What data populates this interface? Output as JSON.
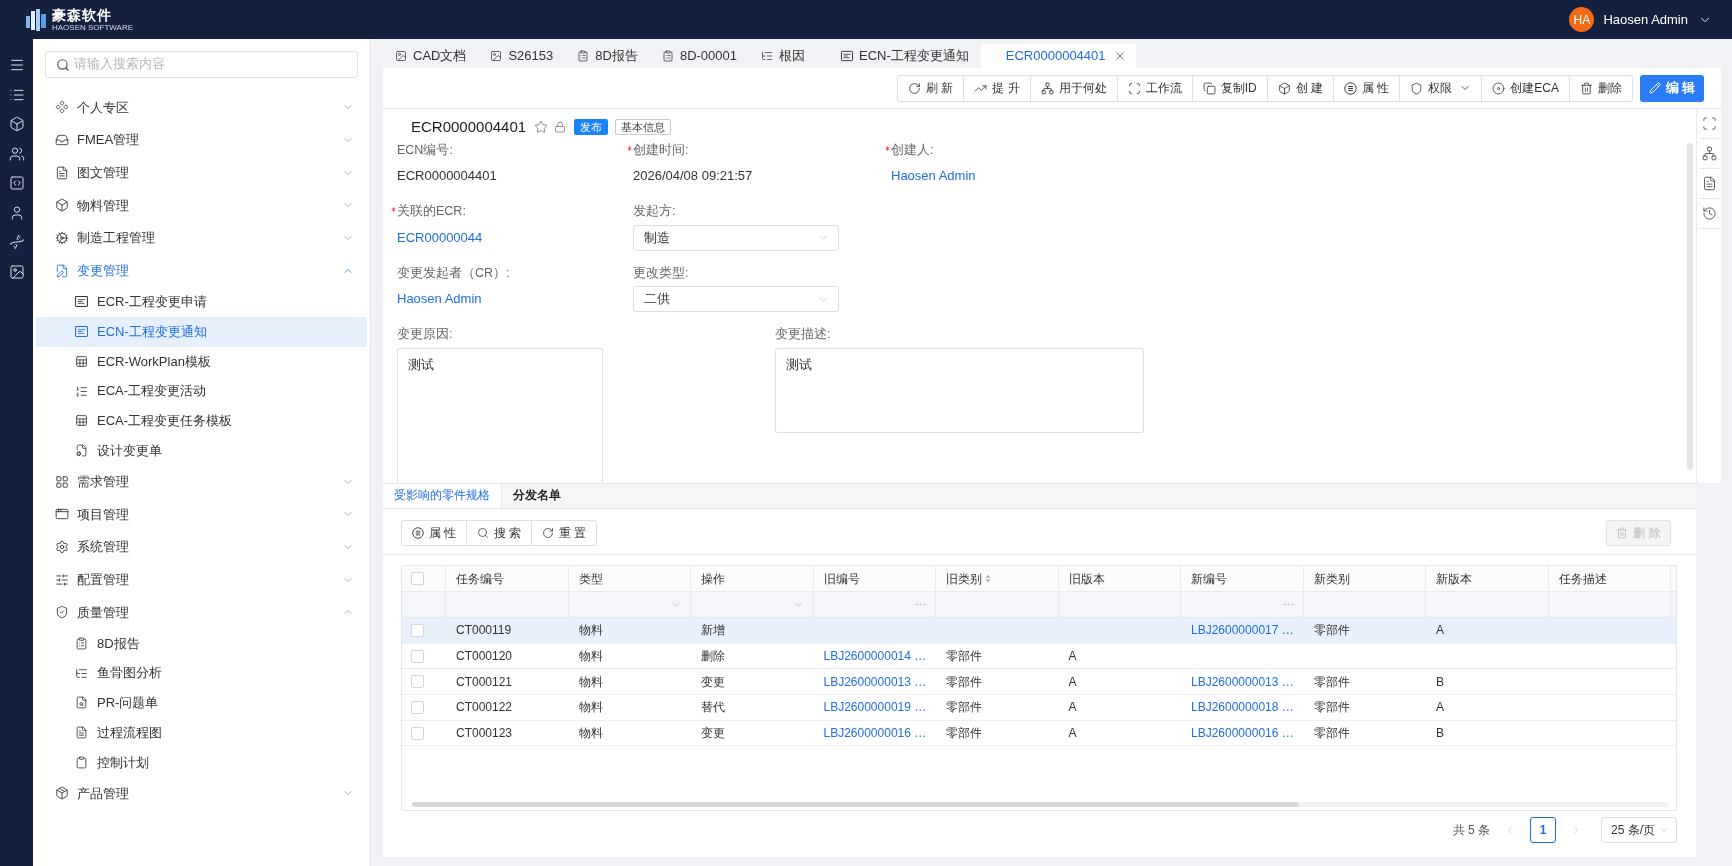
{
  "header": {
    "logo_text": "豪森软件",
    "logo_subtext": "HAOSEN SOFTWARE",
    "user": {
      "initials": "HA",
      "name": "Haosen Admin"
    }
  },
  "sidebar": {
    "search": {
      "placeholder": "请输入搜索内容"
    },
    "items": [
      {
        "label": "个人专区",
        "selected": false,
        "expanded": false
      },
      {
        "label": "FMEA管理",
        "selected": false,
        "expanded": false
      },
      {
        "label": "图文管理",
        "selected": false,
        "expanded": false
      },
      {
        "label": "物料管理",
        "selected": false,
        "expanded": false
      },
      {
        "label": "制造工程管理",
        "selected": false,
        "expanded": false
      },
      {
        "label": "变更管理",
        "selected": true,
        "expanded": true,
        "children": [
          {
            "label": "ECR-工程变更申请",
            "selected": false
          },
          {
            "label": "ECN-工程变更通知",
            "selected": true
          },
          {
            "label": "ECR-WorkPlan模板",
            "selected": false
          },
          {
            "label": "ECA-工程变更活动",
            "selected": false
          },
          {
            "label": "ECA-工程变更任务模板",
            "selected": false
          },
          {
            "label": "设计变更单",
            "selected": false
          }
        ]
      },
      {
        "label": "需求管理",
        "selected": false,
        "expanded": false
      },
      {
        "label": "项目管理",
        "selected": false,
        "expanded": false
      },
      {
        "label": "系统管理",
        "selected": false,
        "expanded": false
      },
      {
        "label": "配置管理",
        "selected": false,
        "expanded": false
      },
      {
        "label": "质量管理",
        "selected": false,
        "expanded": true,
        "children": [
          {
            "label": "8D报告",
            "selected": false
          },
          {
            "label": "鱼骨图分析",
            "selected": false
          },
          {
            "label": "PR-问题单",
            "selected": false
          },
          {
            "label": "过程流程图",
            "selected": false
          },
          {
            "label": "控制计划",
            "selected": false
          }
        ]
      },
      {
        "label": "产品管理",
        "selected": false,
        "expanded": false
      }
    ]
  },
  "tabs": [
    {
      "label": "CAD文档",
      "selected": false
    },
    {
      "label": "S26153",
      "selected": false
    },
    {
      "label": "8D报告",
      "selected": false
    },
    {
      "label": "8D-00001",
      "selected": false
    },
    {
      "label": "根因",
      "selected": false
    },
    {
      "label": "ECN-工程变更通知",
      "selected": false
    },
    {
      "label": "ECR0000004401",
      "selected": true
    }
  ],
  "toolbar": {
    "buttons": [
      {
        "label": "刷 新",
        "kind": "button"
      },
      {
        "label": "提 升",
        "kind": "button"
      },
      {
        "label": "用于何处",
        "kind": "button"
      },
      {
        "label": "工作流",
        "kind": "button"
      },
      {
        "label": "复制ID",
        "kind": "button"
      },
      {
        "label": "创 建",
        "kind": "button"
      },
      {
        "label": "属 性",
        "kind": "button"
      },
      {
        "label": "权限",
        "kind": "dropdown"
      },
      {
        "label": "创建ECA",
        "kind": "button"
      },
      {
        "label": "删除",
        "kind": "button"
      }
    ],
    "primary": {
      "label": "编 辑"
    }
  },
  "record": {
    "title": "ECR0000004401",
    "starred": false,
    "status_tag": "发布",
    "section_tag": "基本信息"
  },
  "form": {
    "rows": [
      [
        {
          "label": "ECN编号:",
          "required": false,
          "kind": "text",
          "value": "ECR0000004401"
        },
        {
          "label": "创建时间:",
          "required": true,
          "kind": "text",
          "value": "2026/04/08 09:21:57"
        },
        {
          "label": "创建人:",
          "required": true,
          "kind": "link",
          "value": "Haosen Admin"
        }
      ],
      [
        {
          "label": "关联的ECR:",
          "required": true,
          "kind": "link",
          "value": "ECR00000044"
        },
        {
          "label": "发起方:",
          "required": false,
          "kind": "select",
          "value": "制造"
        }
      ],
      [
        {
          "label": "变更发起者（CR）:",
          "required": false,
          "kind": "link",
          "value": "Haosen Admin"
        },
        {
          "label": "更改类型:",
          "required": false,
          "kind": "select",
          "value": "二供"
        }
      ],
      [
        {
          "label": "变更原因:",
          "required": false,
          "kind": "textarea",
          "value": "测试"
        },
        {
          "label": "变更描述:",
          "required": false,
          "kind": "textarea",
          "value": "测试"
        }
      ]
    ]
  },
  "detail_tabs": [
    {
      "label": "受影响的零件规格",
      "selected": true
    },
    {
      "label": "分发名单",
      "selected": false
    }
  ],
  "table_toolbar": {
    "buttons": [
      {
        "label": "属 性"
      },
      {
        "label": "搜 索"
      },
      {
        "label": "重 置"
      }
    ],
    "delete": {
      "label": "删 除",
      "disabled": true
    }
  },
  "table": {
    "select_all": {
      "checked": false
    },
    "columns": [
      {
        "label": "任务编号",
        "kind": "text",
        "filter": {
          "kind": "input"
        },
        "sortable": false
      },
      {
        "label": "类型",
        "kind": "text",
        "filter": {
          "kind": "select"
        },
        "sortable": false
      },
      {
        "label": "操作",
        "kind": "text",
        "filter": {
          "kind": "select"
        },
        "sortable": false
      },
      {
        "label": "旧编号",
        "kind": "link",
        "filter": {
          "kind": "picker"
        },
        "sortable": false
      },
      {
        "label": "旧类别",
        "kind": "text",
        "filter": {
          "kind": "input"
        },
        "sortable": true
      },
      {
        "label": "旧版本",
        "kind": "text",
        "filter": {
          "kind": "input"
        },
        "sortable": false
      },
      {
        "label": "新编号",
        "kind": "link",
        "filter": {
          "kind": "picker"
        },
        "sortable": false
      },
      {
        "label": "新类别",
        "kind": "text",
        "filter": {
          "kind": "input"
        },
        "sortable": false
      },
      {
        "label": "新版本",
        "kind": "text",
        "filter": {
          "kind": "input"
        },
        "sortable": false
      },
      {
        "label": "任务描述",
        "filter": {
          "kind": "input"
        },
        "sortable": false
      }
    ],
    "rows": [
      {
        "selected": true,
        "checked": false,
        "cells": [
          "CT000119",
          "物料",
          "新增",
          null,
          null,
          null,
          "LBJ2600000017 …",
          "零部件",
          "A"
        ]
      },
      {
        "selected": false,
        "checked": false,
        "cells": [
          "CT000120",
          "物料",
          "删除",
          "LBJ2600000014 …",
          "零部件",
          "A"
        ]
      },
      {
        "selected": false,
        "checked": false,
        "cells": [
          "CT000121",
          "物料",
          "变更",
          "LBJ2600000013 …",
          "零部件",
          "A",
          "LBJ2600000013 …",
          "零部件",
          "B"
        ]
      },
      {
        "selected": false,
        "checked": false,
        "cells": [
          "CT000122",
          "物料",
          "替代",
          "LBJ2600000019 …",
          "零部件",
          "A",
          "LBJ2600000018 …",
          "零部件",
          "A"
        ]
      },
      {
        "selected": false,
        "checked": false,
        "cells": [
          "CT000123",
          "物料",
          "变更",
          "LBJ2600000016 …",
          "零部件",
          "A",
          "LBJ2600000016 …",
          "零部件",
          "B"
        ]
      }
    ]
  },
  "pagination": {
    "total": "共 5 条",
    "prev": {
      "disabled": true
    },
    "pages": [
      {
        "label": "1",
        "selected": true
      }
    ],
    "next": {
      "disabled": true
    },
    "page_size": "25 条/页"
  }
}
